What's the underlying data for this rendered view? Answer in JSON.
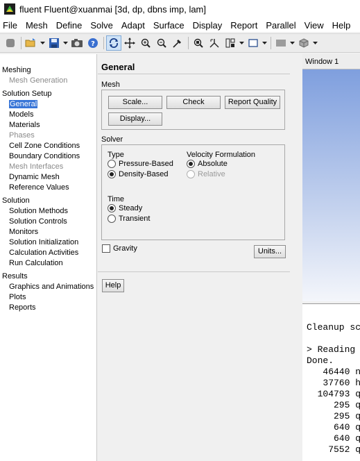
{
  "window": {
    "title": "fluent Fluent@xuanmai  [3d, dp, dbns imp, lam]"
  },
  "menu": [
    "File",
    "Mesh",
    "Define",
    "Solve",
    "Adapt",
    "Surface",
    "Display",
    "Report",
    "Parallel",
    "View",
    "Help"
  ],
  "toolbar": {
    "icons": [
      "stop-icon",
      "open-file-icon",
      "save-icon",
      "snapshot-icon",
      "help-icon",
      "rotate-icon",
      "pan-icon",
      "zoom-icon",
      "zoom-in-icon",
      "probe-icon",
      "zoom-to-fit-icon",
      "mouse-axes-icon",
      "layout-icon",
      "window-icon",
      "scene-icon",
      "view-3d-icon"
    ],
    "active": "rotate-icon"
  },
  "tree": [
    {
      "label": "Meshing",
      "level": "cat",
      "state": "normal"
    },
    {
      "label": "Mesh Generation",
      "level": "sub",
      "state": "disabled"
    },
    {
      "label": "Solution Setup",
      "level": "cat",
      "state": "normal"
    },
    {
      "label": "General",
      "level": "sub",
      "state": "selected"
    },
    {
      "label": "Models",
      "level": "sub",
      "state": "normal"
    },
    {
      "label": "Materials",
      "level": "sub",
      "state": "normal"
    },
    {
      "label": "Phases",
      "level": "sub",
      "state": "disabled"
    },
    {
      "label": "Cell Zone Conditions",
      "level": "sub",
      "state": "normal"
    },
    {
      "label": "Boundary Conditions",
      "level": "sub",
      "state": "normal"
    },
    {
      "label": "Mesh Interfaces",
      "level": "sub",
      "state": "disabled"
    },
    {
      "label": "Dynamic Mesh",
      "level": "sub",
      "state": "normal"
    },
    {
      "label": "Reference Values",
      "level": "sub",
      "state": "normal"
    },
    {
      "label": "Solution",
      "level": "cat",
      "state": "normal"
    },
    {
      "label": "Solution Methods",
      "level": "sub",
      "state": "normal"
    },
    {
      "label": "Solution Controls",
      "level": "sub",
      "state": "normal"
    },
    {
      "label": "Monitors",
      "level": "sub",
      "state": "normal"
    },
    {
      "label": "Solution Initialization",
      "level": "sub",
      "state": "normal"
    },
    {
      "label": "Calculation Activities",
      "level": "sub",
      "state": "normal"
    },
    {
      "label": "Run Calculation",
      "level": "sub",
      "state": "normal"
    },
    {
      "label": "Results",
      "level": "cat",
      "state": "normal"
    },
    {
      "label": "Graphics and Animations",
      "level": "sub",
      "state": "normal"
    },
    {
      "label": "Plots",
      "level": "sub",
      "state": "normal"
    },
    {
      "label": "Reports",
      "level": "sub",
      "state": "normal"
    }
  ],
  "panel": {
    "title": "General",
    "mesh": {
      "label": "Mesh",
      "scale": "Scale...",
      "check": "Check",
      "report_quality": "Report Quality",
      "display": "Display..."
    },
    "solver": {
      "label": "Solver",
      "type_label": "Type",
      "pressure_based": "Pressure-Based",
      "density_based": "Density-Based",
      "type_selected": "Density-Based",
      "velocity_label": "Velocity Formulation",
      "absolute": "Absolute",
      "relative": "Relative",
      "velocity_selected": "Absolute",
      "time_label": "Time",
      "steady": "Steady",
      "transient": "Transient",
      "time_selected": "Steady"
    },
    "gravity": {
      "label": "Gravity",
      "checked": false
    },
    "units": "Units...",
    "help": "Help"
  },
  "graphics": {
    "tab": "Window 1"
  },
  "console": {
    "lines": [
      "",
      "Cleanup sc",
      "",
      "> Reading ",
      "Done.",
      "   46440 n",
      "   37760 h",
      "  104793 q",
      "     295 q",
      "     295 q",
      "     640 q",
      "     640 q",
      "    7552 q"
    ]
  }
}
